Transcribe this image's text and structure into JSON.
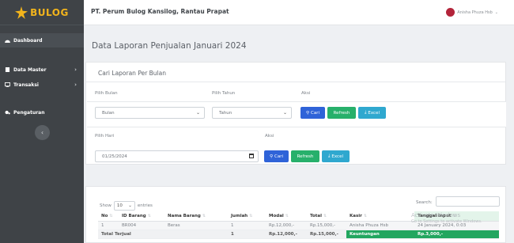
{
  "brand": {
    "name": "BULOG",
    "color": "#f2b41c"
  },
  "sidebar": {
    "items": [
      {
        "label": "Dashboard",
        "icon": "dashboard-icon",
        "has_children": false
      },
      {
        "label": "Data Master",
        "icon": "database-icon",
        "has_children": true
      },
      {
        "label": "Transaksi",
        "icon": "transaction-icon",
        "has_children": true
      },
      {
        "label": "Pengaturan",
        "icon": "gear-icon",
        "has_children": false
      }
    ],
    "collapse_icon": "chevron-left-icon"
  },
  "topbar": {
    "org_name": "PT. Perum Bulog Kansilog, Rantau Prapat",
    "user_name": "Anisha Phuza Hsb",
    "user_menu_icon": "chevron-down-icon"
  },
  "page": {
    "title": "Data Laporan Penjualan Januari 2024"
  },
  "monthly_filter": {
    "card_title": "Cari Laporan Per Bulan",
    "month_label": "Pilih Bulan",
    "month_value": "Bulan",
    "year_label": "Pilih Tahun",
    "year_value": "Tahun",
    "action_label": "Aksi",
    "btn_search": "Cari",
    "btn_refresh": "Refresh",
    "btn_excel": "Excel"
  },
  "daily_filter": {
    "day_label": "Pilih Hari",
    "date_value": "01/25/2024",
    "action_label": "Aksi",
    "btn_search": "Cari",
    "btn_refresh": "Refresh",
    "btn_excel": "Excel"
  },
  "table_controls": {
    "show_label": "Show",
    "entries_value": "10",
    "entries_label": "entries",
    "search_label": "Search:"
  },
  "table": {
    "columns": [
      "No",
      "ID Barang",
      "Nama Barang",
      "Jumlah",
      "Modal",
      "Total",
      "Kasir",
      "Tanggal Input"
    ],
    "rows": [
      [
        "1",
        "BR004",
        "Beras",
        "1",
        "Rp.12,000,-",
        "Rp.15,000,-",
        "Anisha Phuza Hsb",
        "24 January 2024, 0:03"
      ]
    ],
    "total_row": {
      "label": "Total Terjual",
      "jumlah": "1",
      "modal": "Rp.12,000,-",
      "total": "Rp.15,000,-",
      "kasir": "Keuntungan",
      "tanggal": "Rp.3,000,-"
    }
  },
  "watermark": {
    "line1": "Activate Windows",
    "line2": "Go to Settings to activate Windows."
  },
  "colors": {
    "sidebar_bg": "#3f4347",
    "primary": "#2f63d8",
    "success": "#27b06b",
    "info": "#2fa8cf",
    "highlight_green": "#22a65f"
  }
}
